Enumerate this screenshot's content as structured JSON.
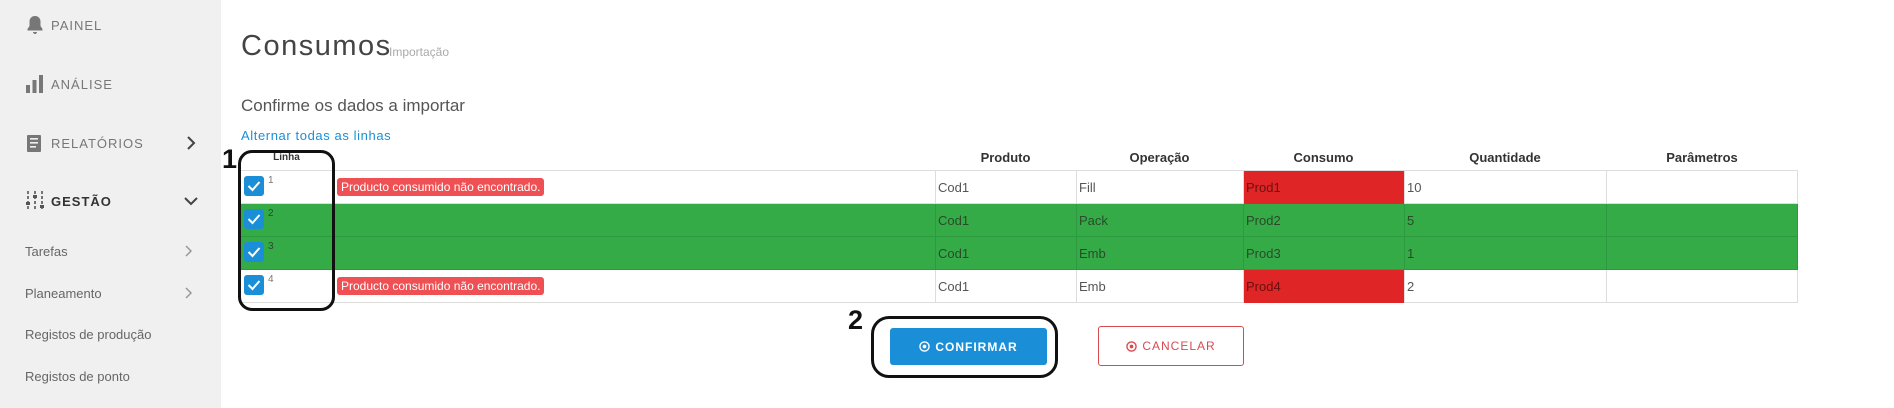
{
  "sidebar": {
    "main_items": [
      {
        "label": "PAINEL",
        "icon": "bell-icon"
      },
      {
        "label": "ANÁLISE",
        "icon": "bar-chart-icon"
      },
      {
        "label": "RELATÓRIOS",
        "icon": "document-icon"
      },
      {
        "label": "GESTÃO",
        "icon": "sliders-icon"
      }
    ],
    "sub_items": [
      {
        "label": "Tarefas"
      },
      {
        "label": "Planeamento"
      },
      {
        "label": "Registos de produção"
      },
      {
        "label": "Registos de ponto"
      }
    ]
  },
  "page": {
    "title": "Consumos",
    "subtitle": "Importação",
    "section_title": "Confirme os dados a importar",
    "toggle_all_link": "Alternar todas as linhas"
  },
  "table": {
    "columns": {
      "line": "Linha",
      "product": "Produto",
      "operation": "Operação",
      "consumption": "Consumo",
      "quantity": "Quantidade",
      "parameters": "Parâmetros"
    },
    "rows": [
      {
        "line": "1",
        "checked": true,
        "status": "error",
        "error": "Producto consumido não encontrado.",
        "product": "Cod1",
        "operation": "Fill",
        "consumption": "Prod1",
        "quantity": "10",
        "parameters": ""
      },
      {
        "line": "2",
        "checked": true,
        "status": "ok",
        "error": "",
        "product": "Cod1",
        "operation": "Pack",
        "consumption": "Prod2",
        "quantity": "5",
        "parameters": ""
      },
      {
        "line": "3",
        "checked": true,
        "status": "ok",
        "error": "",
        "product": "Cod1",
        "operation": "Emb",
        "consumption": "Prod3",
        "quantity": "1",
        "parameters": ""
      },
      {
        "line": "4",
        "checked": true,
        "status": "error",
        "error": "Producto consumido não encontrado.",
        "product": "Cod1",
        "operation": "Emb",
        "consumption": "Prod4",
        "quantity": "2",
        "parameters": ""
      }
    ]
  },
  "annotations": {
    "one": "1",
    "two": "2"
  },
  "buttons": {
    "confirm": {
      "label": "CONFIRMAR",
      "icon": "circle-check-icon"
    },
    "cancel": {
      "label": "CANCELAR",
      "icon": "circle-x-icon"
    }
  },
  "colors": {
    "accent": "#1a8fd8",
    "row_ok": "#35ab48",
    "consumption_error": "#e02527",
    "error_badge": "#ee5054",
    "cancel": "#d94a4f"
  }
}
